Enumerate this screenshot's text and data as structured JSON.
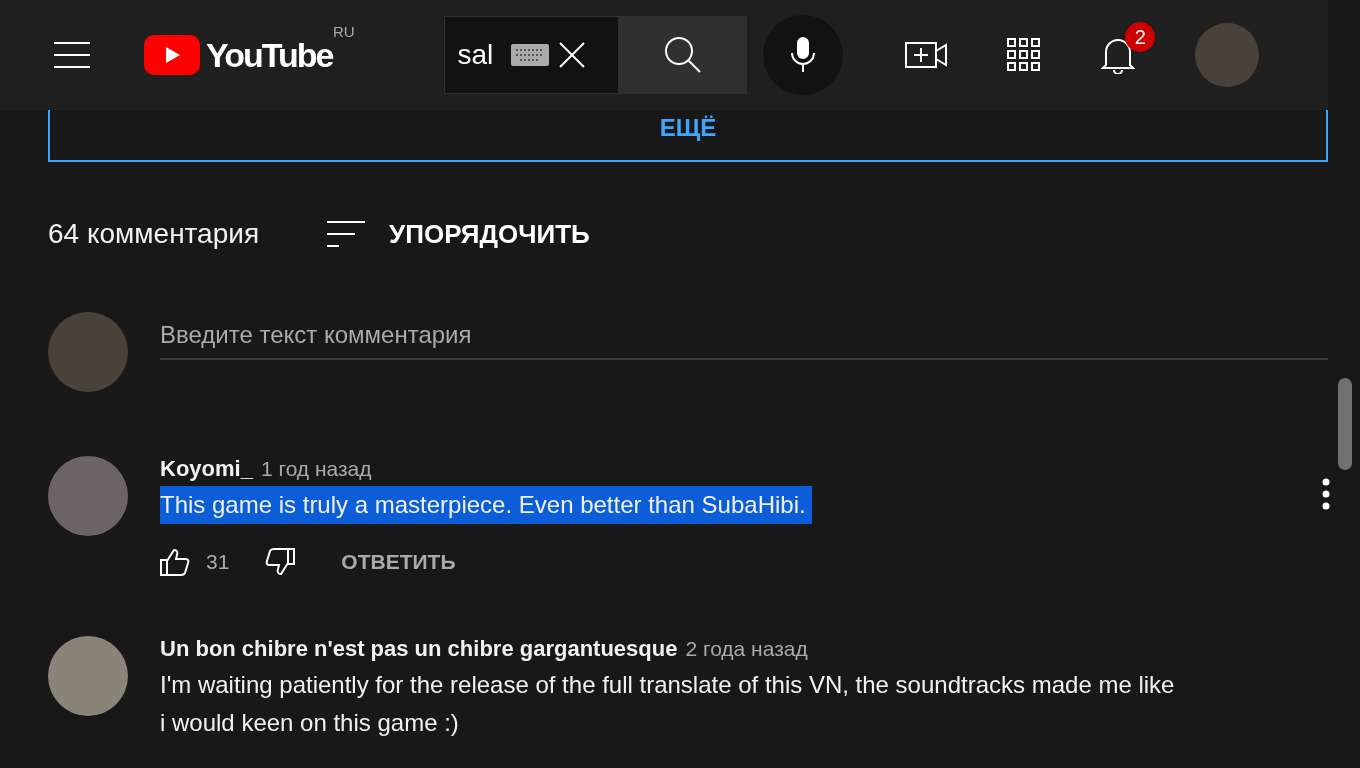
{
  "header": {
    "logo_text": "YouTube",
    "region": "RU",
    "search": {
      "value": "sal"
    },
    "notifications": {
      "count": "2"
    }
  },
  "more_button": {
    "label": "ЕЩЁ"
  },
  "comments_header": {
    "count": "64 комментария",
    "sort_label": "УПОРЯДОЧИТЬ"
  },
  "new_comment": {
    "placeholder": "Введите текст комментария"
  },
  "comments": [
    {
      "author": "Koyomi_",
      "time": "1 год назад",
      "text": "This game is truly a masterpiece. Even better than SubaHibi.",
      "text_selected": true,
      "likes": "31",
      "reply_label": "ОТВЕТИТЬ"
    },
    {
      "author": "Un bon chibre n'est pas un chibre gargantuesque",
      "time": "2 года назад",
      "text": "I'm waiting patiently for the release of the full translate of this VN, the soundtracks made me like i would keen on this game :)",
      "text_selected": false
    }
  ]
}
